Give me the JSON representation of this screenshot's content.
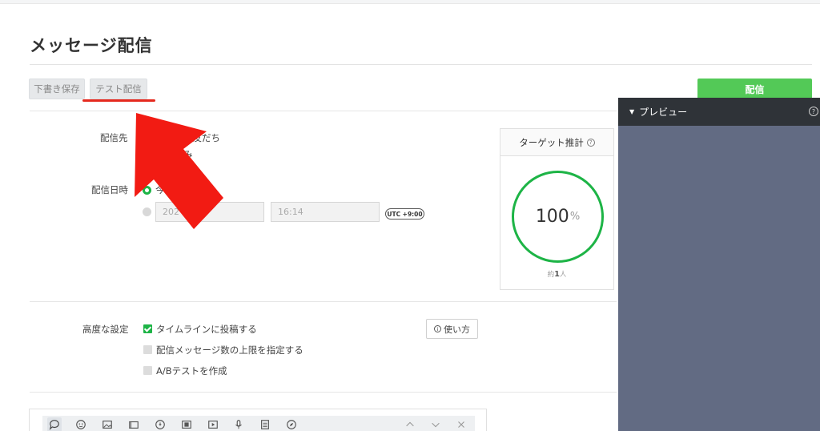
{
  "header": {
    "title": "メッセージ配信"
  },
  "actions": {
    "draft_label": "下書き保存",
    "test_label": "テスト配信",
    "send_label": "配信"
  },
  "recipients": {
    "label": "配信先",
    "option_text": "の友だち",
    "sub_text": "み"
  },
  "schedule": {
    "label": "配信日時",
    "now_text": "今",
    "date_value": "202",
    "time_value": "16:14",
    "timezone": "UTC +9:00"
  },
  "target": {
    "title": "ターゲット推計",
    "percent": "100",
    "percent_unit": "%",
    "people_prefix": "約",
    "people_count": "1",
    "people_suffix": "人"
  },
  "advanced": {
    "label": "高度な設定",
    "options": [
      {
        "label": "タイムラインに投稿する",
        "checked": true
      },
      {
        "label": "配信メッセージ数の上限を指定する",
        "checked": false
      },
      {
        "label": "A/Bテストを作成",
        "checked": false
      }
    ],
    "howto_label": "使い方"
  },
  "toolbar": {
    "icons": [
      "chat-bubble-icon",
      "emoji-icon",
      "image-icon",
      "card-icon",
      "coupon-icon",
      "video-icon",
      "play-icon",
      "mic-icon",
      "list-icon",
      "compass-icon"
    ],
    "controls": [
      "chevron-up-icon",
      "chevron-down-icon",
      "close-icon"
    ]
  },
  "preview": {
    "title": "プレビュー"
  },
  "colors": {
    "accent": "#1db446",
    "send_button": "#53c957",
    "annotation": "#e5291e",
    "preview_bg": "#626b83"
  }
}
